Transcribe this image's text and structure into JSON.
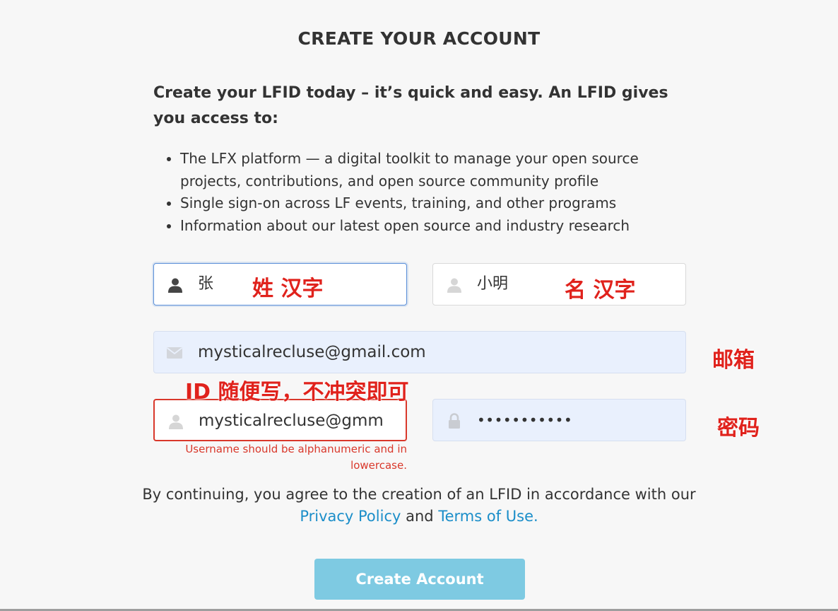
{
  "page": {
    "title": "CREATE YOUR ACCOUNT",
    "intro": "Create your LFID today – it’s quick and easy. An LFID gives you access to:",
    "benefits": [
      "The LFX platform — a digital toolkit to manage your open source projects, contributions, and open source community profile",
      "Single sign-on across LF events, training, and other programs",
      "Information about our latest open source and industry research"
    ]
  },
  "form": {
    "first_name": {
      "value": "张",
      "icon": "user-icon"
    },
    "last_name": {
      "value": "小明",
      "icon": "user-icon"
    },
    "email": {
      "value": "mysticalrecluse@gmail.com",
      "icon": "envelope-icon"
    },
    "username": {
      "value": "mysticalrecluse@gmm",
      "icon": "user-icon",
      "error": "Username should be alphanumeric and in lowercase."
    },
    "password": {
      "value": "•••••••••••",
      "icon": "lock-icon"
    }
  },
  "annotations": {
    "surname": "姓 汉字",
    "given_name": "名 汉字",
    "email": "邮箱",
    "id": "ID 随便写，不冲突即可",
    "password": "密码"
  },
  "agreement": {
    "prefix": "By continuing, you agree to the creation of an LFID in accordance with our",
    "privacy_link": "Privacy Policy",
    "and": "and",
    "terms_link": "Terms of Use."
  },
  "submit": {
    "label": "Create Account"
  },
  "colors": {
    "link": "#1b8ec9",
    "error": "#d9382b",
    "annotation": "#e0221c",
    "button": "#7ecae2",
    "filled_field": "#e9f0fd"
  }
}
